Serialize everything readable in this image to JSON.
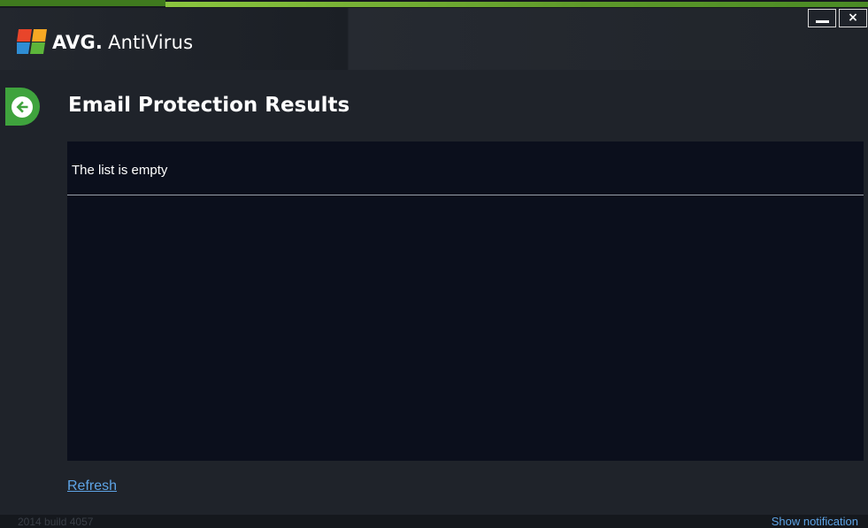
{
  "window": {
    "brand": "AVG.",
    "product": "AntiVirus",
    "minimize_glyph": "",
    "close_glyph": "×"
  },
  "page": {
    "title": "Email Protection Results"
  },
  "results": {
    "empty_message": "The list is empty"
  },
  "actions": {
    "refresh_label": "Refresh"
  },
  "footer": {
    "build_info": "2014  build 4057",
    "show_notification_label": "Show notification"
  },
  "colors": {
    "accent_green": "#8cc63f",
    "back_button_green": "#3fa33d",
    "link_blue": "#5ea4e6",
    "panel_bg": "#0b0f1c",
    "window_bg": "#1f232a"
  },
  "icons": {
    "logo": "avg-logo-icon",
    "back": "arrow-left-icon",
    "minimize": "minimize-icon",
    "close": "close-icon"
  }
}
